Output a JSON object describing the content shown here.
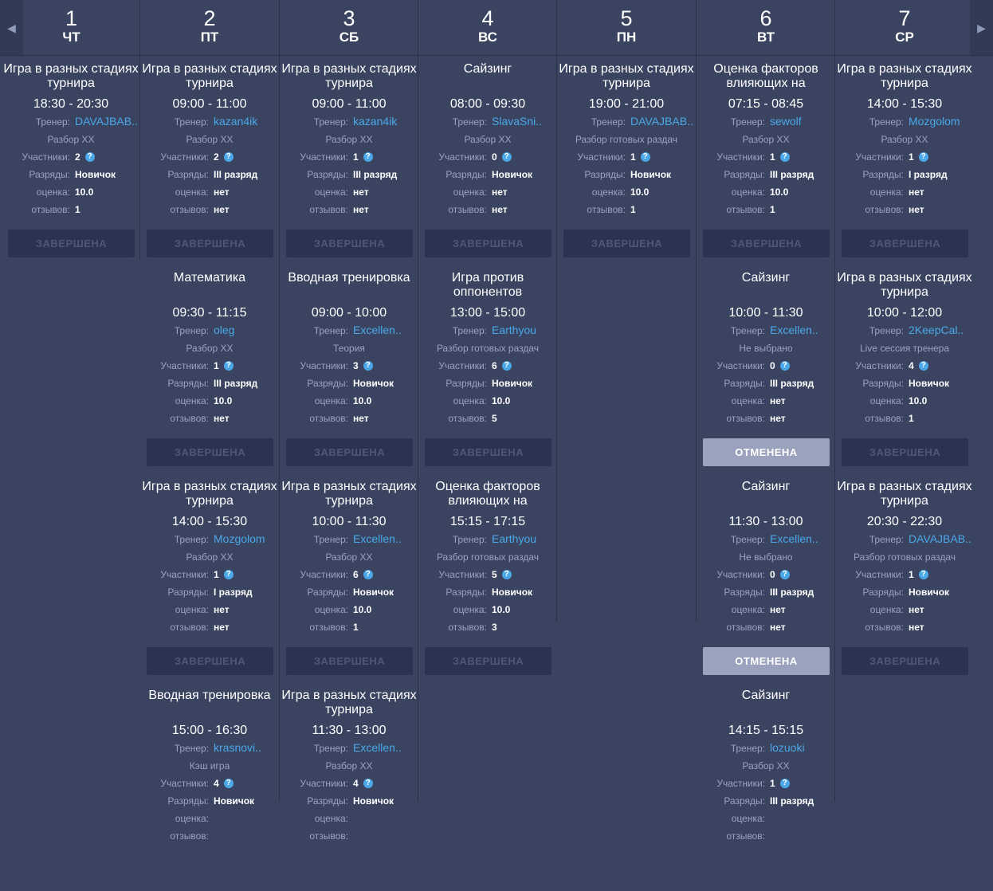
{
  "labels": {
    "coach": "Тренер:",
    "participants": "Участники:",
    "ranks": "Разряды:",
    "rating": "оценка:",
    "reviews": "отзывов:",
    "done": "ЗАВЕРШЕНА",
    "cancelled": "ОТМЕНЕНА",
    "help": "?"
  },
  "nav": {
    "prev": "◀",
    "next": "▶"
  },
  "days": [
    {
      "num": "1",
      "wd": "ЧТ",
      "sessions": [
        {
          "title": "Игра в разных стадиях турнира",
          "time": "18:30 - 20:30",
          "coach": "DAVAJBAB..",
          "category": "Разбор ХХ",
          "participants": "2",
          "ranks": "Новичок",
          "rating": "10.0",
          "reviews": "1",
          "status": "ЗАВЕРШЕНА"
        }
      ]
    },
    {
      "num": "2",
      "wd": "ПТ",
      "sessions": [
        {
          "title": "Игра в разных стадиях турнира",
          "time": "09:00 - 11:00",
          "coach": "kazan4ik",
          "category": "Разбор ХХ",
          "participants": "2",
          "ranks": "III разряд",
          "rating": "нет",
          "reviews": "нет",
          "status": "ЗАВЕРШЕНА"
        },
        {
          "title": "Математика",
          "time": "09:30 - 11:15",
          "coach": "oleg",
          "category": "Разбор ХХ",
          "participants": "1",
          "ranks": "III разряд",
          "rating": "10.0",
          "reviews": "нет",
          "status": "ЗАВЕРШЕНА"
        },
        {
          "title": "Игра в разных стадиях турнира",
          "time": "14:00 - 15:30",
          "coach": "Mozgolom",
          "category": "Разбор ХХ",
          "participants": "1",
          "ranks": "I разряд",
          "rating": "нет",
          "reviews": "нет",
          "status": "ЗАВЕРШЕНА"
        },
        {
          "title": "Вводная тренировка",
          "time": "15:00 - 16:30",
          "coach": "krasnovi..",
          "category": "Кэш игра",
          "participants": "4",
          "ranks": "Новичок",
          "rating": "",
          "reviews": "",
          "status": ""
        }
      ]
    },
    {
      "num": "3",
      "wd": "СБ",
      "sessions": [
        {
          "title": "Игра в разных стадиях турнира",
          "time": "09:00 - 11:00",
          "coach": "kazan4ik",
          "category": "Разбор ХХ",
          "participants": "1",
          "ranks": "III разряд",
          "rating": "нет",
          "reviews": "нет",
          "status": "ЗАВЕРШЕНА"
        },
        {
          "title": "Вводная тренировка",
          "time": "09:00 - 10:00",
          "coach": "Excellen..",
          "category": "Теория",
          "participants": "3",
          "ranks": "Новичок",
          "rating": "10.0",
          "reviews": "нет",
          "status": "ЗАВЕРШЕНА"
        },
        {
          "title": "Игра в разных стадиях турнира",
          "time": "10:00 - 11:30",
          "coach": "Excellen..",
          "category": "Разбор ХХ",
          "participants": "6",
          "ranks": "Новичок",
          "rating": "10.0",
          "reviews": "1",
          "status": "ЗАВЕРШЕНА"
        },
        {
          "title": "Игра в разных стадиях турнира",
          "time": "11:30 - 13:00",
          "coach": "Excellen..",
          "category": "Разбор ХХ",
          "participants": "4",
          "ranks": "Новичок",
          "rating": "",
          "reviews": "",
          "status": ""
        }
      ]
    },
    {
      "num": "4",
      "wd": "ВС",
      "sessions": [
        {
          "title": "Сайзинг",
          "time": "08:00 - 09:30",
          "coach": "SlavaSni..",
          "category": "Разбор ХХ",
          "participants": "0",
          "ranks": "Новичок",
          "rating": "нет",
          "reviews": "нет",
          "status": "ЗАВЕРШЕНА"
        },
        {
          "title": "Игра против оппонентов",
          "time": "13:00 - 15:00",
          "coach": "Earthyou",
          "category": "Разбор готовых раздач",
          "participants": "6",
          "ranks": "Новичок",
          "rating": "10.0",
          "reviews": "5",
          "status": "ЗАВЕРШЕНА"
        },
        {
          "title": "Оценка факторов влияющих на",
          "time": "15:15 - 17:15",
          "coach": "Earthyou",
          "category": "Разбор готовых раздач",
          "participants": "5",
          "ranks": "Новичок",
          "rating": "10.0",
          "reviews": "3",
          "status": "ЗАВЕРШЕНА"
        }
      ]
    },
    {
      "num": "5",
      "wd": "ПН",
      "sessions": [
        {
          "title": "Игра в разных стадиях турнира",
          "time": "19:00 - 21:00",
          "coach": "DAVAJBAB..",
          "category": "Разбор готовых раздач",
          "participants": "1",
          "ranks": "Новичок",
          "rating": "10.0",
          "reviews": "1",
          "status": "ЗАВЕРШЕНА"
        }
      ]
    },
    {
      "num": "6",
      "wd": "ВТ",
      "sessions": [
        {
          "title": "Оценка факторов влияющих на",
          "time": "07:15 - 08:45",
          "coach": "sewolf",
          "category": "Разбор ХХ",
          "participants": "1",
          "ranks": "III разряд",
          "rating": "10.0",
          "reviews": "1",
          "status": "ЗАВЕРШЕНА"
        },
        {
          "title": "Сайзинг",
          "time": "10:00 - 11:30",
          "coach": "Excellen..",
          "category": "Не выбрано",
          "participants": "0",
          "ranks": "III разряд",
          "rating": "нет",
          "reviews": "нет",
          "status": "ОТМЕНЕНА"
        },
        {
          "title": "Сайзинг",
          "time": "11:30 - 13:00",
          "coach": "Excellen..",
          "category": "Не выбрано",
          "participants": "0",
          "ranks": "III разряд",
          "rating": "нет",
          "reviews": "нет",
          "status": "ОТМЕНЕНА"
        },
        {
          "title": "Сайзинг",
          "time": "14:15 - 15:15",
          "coach": "lozuoki",
          "category": "Разбор ХХ",
          "participants": "1",
          "ranks": "III разряд",
          "rating": "",
          "reviews": "",
          "status": ""
        }
      ]
    },
    {
      "num": "7",
      "wd": "СР",
      "sessions": [
        {
          "title": "Игра в разных стадиях турнира",
          "time": "14:00 - 15:30",
          "coach": "Mozgolom",
          "category": "Разбор ХХ",
          "participants": "1",
          "ranks": "I разряд",
          "rating": "нет",
          "reviews": "нет",
          "status": "ЗАВЕРШЕНА"
        },
        {
          "title": "Игра в разных стадиях турнира",
          "time": "10:00 - 12:00",
          "coach": "2KeepCal..",
          "category": "Live сессия тренера",
          "participants": "4",
          "ranks": "Новичок",
          "rating": "10.0",
          "reviews": "1",
          "status": "ЗАВЕРШЕНА"
        },
        {
          "title": "Игра в разных стадиях турнира",
          "time": "20:30 - 22:30",
          "coach": "DAVAJBAB..",
          "category": "Разбор готовых раздач",
          "participants": "1",
          "ranks": "Новичок",
          "rating": "нет",
          "reviews": "нет",
          "status": "ЗАВЕРШЕНА"
        }
      ]
    }
  ]
}
